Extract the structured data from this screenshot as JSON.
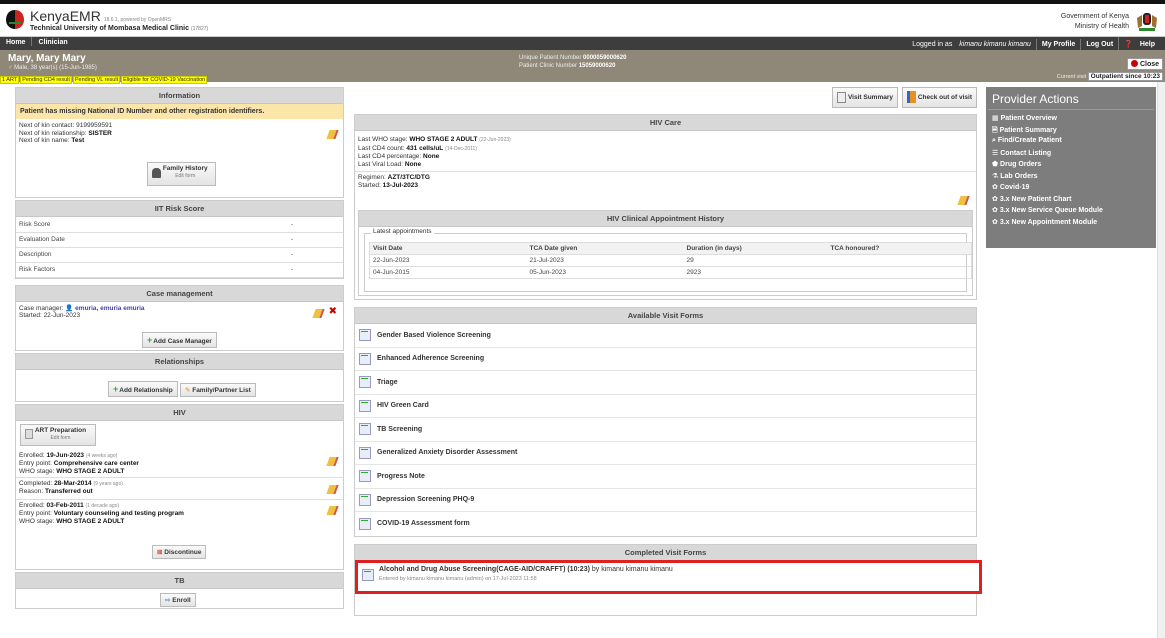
{
  "app": {
    "name": "KenyaEMR",
    "version": "18.6.1, powered by OpenMRS",
    "clinic": "Technical University of Mombasa Medical Clinic",
    "clinic_code": "(17827)",
    "gov_line1": "Government of Kenya",
    "gov_line2": "Ministry of Health"
  },
  "nav": {
    "home": "Home",
    "clinician": "Clinician",
    "logged_in_prefix": "Logged in as",
    "logged_in_user": "kimanu kimanu kimanu",
    "my_profile": "My Profile",
    "log_out": "Log Out",
    "help": "Help"
  },
  "patient": {
    "name": "Mary, Mary Mary",
    "info": "Male, 38 year(s) (15-Jun-1985)",
    "upn_label": "Unique Patient Number",
    "upn": "0000059000620",
    "clinic_number_label": "Patient Clinic Number",
    "clinic_number": "15059000620",
    "close": "Close",
    "current_visit_label": "Current visit",
    "current_visit": "Outpatient since 10:23"
  },
  "flags": [
    "1 ART",
    "Pending CD4 result",
    "Pending VL result",
    "Eligible for COVID-19 Vaccination"
  ],
  "information": {
    "title": "Information",
    "warning": "Patient has missing National ID Number and other registration identifiers.",
    "kin_contact_label": "Next of kin contact:",
    "kin_contact": "9199959591",
    "kin_relationship_label": "Next of kin relationship:",
    "kin_relationship": "SISTER",
    "kin_name_label": "Next of kin name:",
    "kin_name": "Test",
    "family_history": "Family History",
    "family_history_sub": "Edit form"
  },
  "iit": {
    "title": "IIT Risk Score",
    "rows": [
      {
        "label": "Risk Score",
        "value": "-"
      },
      {
        "label": "Evaluation Date",
        "value": "-"
      },
      {
        "label": "Description",
        "value": "-"
      },
      {
        "label": "Risk Factors",
        "value": "-"
      }
    ]
  },
  "case": {
    "title": "Case management",
    "manager_label": "Case manager:",
    "manager": "emuria, emuria emuria",
    "started": "Started: 22-Jun-2023",
    "add": "Add Case Manager"
  },
  "relationships": {
    "title": "Relationships",
    "add": "Add Relationship",
    "list": "Family/Partner List"
  },
  "hiv": {
    "title": "HIV",
    "art_prep": "ART Preparation",
    "art_prep_sub": "Edit form",
    "e1_enrolled_label": "Enrolled:",
    "e1_enrolled": "19-Jun-2023",
    "e1_ago": "(4 weeks ago)",
    "e1_entry_label": "Entry point:",
    "e1_entry": "Comprehensive care center",
    "e1_who_label": "WHO stage:",
    "e1_who": "WHO STAGE 2 ADULT",
    "e2_completed_label": "Completed:",
    "e2_completed": "28-Mar-2014",
    "e2_ago": "(9 years ago)",
    "e2_reason_label": "Reason:",
    "e2_reason": "Transferred out",
    "e3_enrolled_label": "Enrolled:",
    "e3_enrolled": "03-Feb-2011",
    "e3_ago": "(1 decade ago)",
    "e3_entry_label": "Entry point:",
    "e3_entry": "Voluntary counseling and testing program",
    "e3_who_label": "WHO stage:",
    "e3_who": "WHO STAGE 2 ADULT",
    "discontinue": "Discontinue"
  },
  "tb": {
    "title": "TB",
    "enroll": "Enroll"
  },
  "toolbar": {
    "visit_summary": "Visit Summary",
    "check_out": "Check out of visit"
  },
  "hivcare": {
    "title": "HIV Care",
    "who_label": "Last WHO stage:",
    "who": "WHO STAGE 2 ADULT",
    "who_date": "(22-Jun-2023)",
    "cd4_label": "Last CD4 count:",
    "cd4": "431 cells/uL",
    "cd4_date": "(14-Dec-2011)",
    "cd4pct_label": "Last CD4 percentage:",
    "cd4pct": "None",
    "vl_label": "Last Viral Load:",
    "vl": "None",
    "regimen_label": "Regimen:",
    "regimen": "AZT/3TC/DTG",
    "started_label": "Started:",
    "started": "13-Jul-2023"
  },
  "appointments": {
    "title": "HIV Clinical Appointment History",
    "legend": "Latest appointments",
    "headers": [
      "Visit Date",
      "TCA Date given",
      "Duration (in days)",
      "TCA honoured?"
    ],
    "rows": [
      [
        "22-Jun-2023",
        "21-Jul-2023",
        "29",
        ""
      ],
      [
        "04-Jun-2015",
        "05-Jun-2023",
        "2923",
        ""
      ]
    ]
  },
  "available_forms": {
    "title": "Available Visit Forms",
    "items": [
      "Gender Based Violence Screening",
      "Enhanced Adherence Screening",
      "Triage",
      "HIV Green Card",
      "TB Screening",
      "Generalized Anxiety Disorder Assessment",
      "Progress Note",
      "Depression Screening PHQ-9",
      "COVID-19 Assessment form"
    ]
  },
  "completed_forms": {
    "title": "Completed Visit Forms",
    "item_title": "Alcohol and Drug Abuse Screening(CAGE-AID/CRAFFT) (10:23)",
    "item_by": "by kimanu kimanu kimanu",
    "item_entered": "Entered by kimanu kimanu kimanu (admin) on 17-Jul-2023 11:58"
  },
  "provider_actions": {
    "title": "Provider Actions",
    "items": [
      {
        "icon": "grid-icon",
        "label": "Patient Overview"
      },
      {
        "icon": "document-icon",
        "label": "Patient Summary"
      },
      {
        "icon": "search-icon",
        "label": "Find/Create Patient"
      },
      {
        "icon": "list-icon",
        "label": "Contact Listing"
      },
      {
        "icon": "pill-icon",
        "label": "Drug Orders"
      },
      {
        "icon": "flask-icon",
        "label": "Lab Orders"
      },
      {
        "icon": "gear-icon",
        "label": "Covid-19"
      },
      {
        "icon": "gear-icon",
        "label": "3.x New Patient Chart"
      },
      {
        "icon": "gear-icon",
        "label": "3.x New Service Queue Module"
      },
      {
        "icon": "gear-icon",
        "label": "3.x New Appointment Module"
      }
    ]
  },
  "colors": {
    "highlight": "#e02020",
    "nav": "#3d3d3d",
    "patient_bar": "#8f8777",
    "flag": "#ffff00",
    "provider_bg": "#7d7d7d"
  }
}
